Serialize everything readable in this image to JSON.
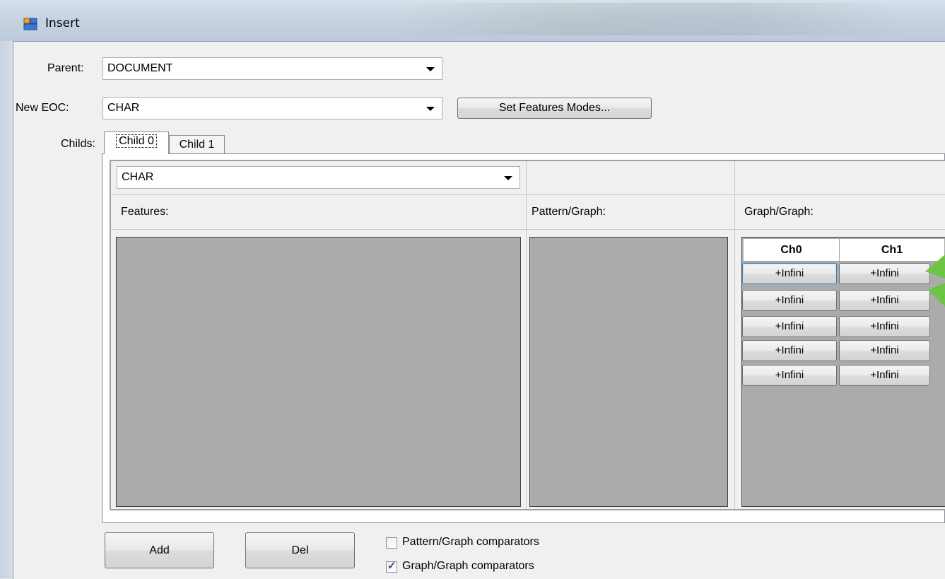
{
  "window": {
    "title": "Insert"
  },
  "form": {
    "parent_label": "Parent:",
    "parent_value": "DOCUMENT",
    "new_eoc_label": "New EOC:",
    "new_eoc_value": "CHAR",
    "set_features_button": "Set Features Modes...",
    "childs_label": "Childs:"
  },
  "tabs": [
    {
      "label": "Child 0",
      "selected": true
    },
    {
      "label": "Child 1",
      "selected": false
    }
  ],
  "child_panel": {
    "type_value": "CHAR",
    "features_header": "Features:",
    "pattern_graph_header": "Pattern/Graph:",
    "graph_graph_header": "Graph/Graph:"
  },
  "graph_grid": {
    "columns": [
      "Ch0",
      "Ch1"
    ],
    "rows": [
      [
        "+Infini",
        "+Infini"
      ],
      [
        "+Infini",
        "+Infini"
      ],
      [
        "+Infini",
        "+Infini"
      ],
      [
        "+Infini",
        "+Infini"
      ],
      [
        "+Infini",
        "+Infini"
      ]
    ]
  },
  "footer": {
    "add_button": "Add",
    "del_button": "Del",
    "pattern_graph_comparators": {
      "label": "Pattern/Graph comparators",
      "checked": false
    },
    "graph_graph_comparators": {
      "label": "Graph/Graph comparators",
      "checked": true
    }
  },
  "colors": {
    "annotation_arrow": "#6cc644",
    "grid_background": "#ababab"
  }
}
